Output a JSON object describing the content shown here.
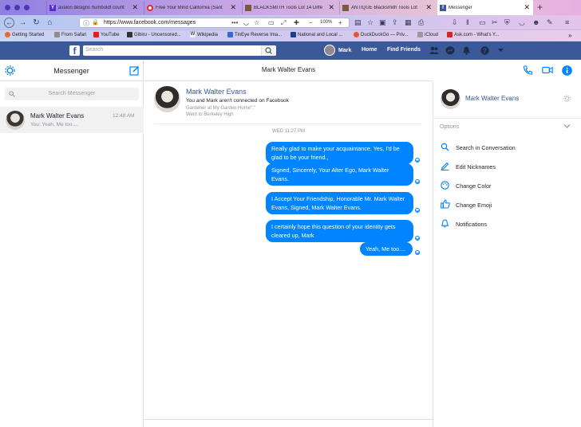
{
  "browser": {
    "tabs": [
      {
        "title": "avalon designs humboldt count",
        "icon_letter": "Y",
        "icon_color": "#5b2bd1"
      },
      {
        "title": "Free Your Mind California (Sant",
        "icon_letter": "",
        "icon_color": "#e22828"
      },
      {
        "title": "BLACKSMITH Tools Lot 14 Diffe",
        "icon_letter": "",
        "icon_color": "#7a5a3a"
      },
      {
        "title": "ANTIQUE Blacksmith Tools Lot",
        "icon_letter": "",
        "icon_color": "#7a5a3a"
      },
      {
        "title": "Messenger",
        "icon_letter": "f",
        "icon_color": "#3b5998"
      }
    ],
    "url": "https://www.facebook.com/messages",
    "zoom": "100%",
    "bookmarks": [
      "Getting Started",
      "From Safari",
      "YouTube",
      "Gibiru - Uncensored...",
      "Wikipedia",
      "TinEye Reverse Ima...",
      "National and Local ...",
      "DuckDuckGo — Priv...",
      "iCloud",
      "Ask.com - What's Y..."
    ]
  },
  "facebook": {
    "search_placeholder": "Search",
    "user_name": "Mark",
    "nav_home": "Home",
    "nav_find_friends": "Find Friends"
  },
  "messenger": {
    "title": "Messenger",
    "search_placeholder": "Search Messenger",
    "conversation": {
      "name": "Mark Walter Evans",
      "time": "12:48 AM",
      "preview": "You: Yeah, Me too...."
    }
  },
  "chat": {
    "header_title": "Mark Walter Evans",
    "profile_name": "Mark Walter Evans",
    "profile_status": "You and Mark aren't connected on Facebook",
    "profile_detail1": "Gardener at My Garden Home\";\"",
    "profile_detail2": "Went to Berkeley High",
    "timestamp": "WED 11:27 PM",
    "messages": [
      "Really glad to make your acquaintance. Yes, I'd be glad to be your friend.,",
      "Signed, Sincerely, Your Alter Ego, Mark Walter Evans.",
      "I Accept Your Friendship, Honorable Mr. Mark Walter Evans, Signed,  Mark Walter Evans.",
      "I certainly hope this question of your identity gets  cleared up, Mark",
      "Yeah, Me too...."
    ]
  },
  "details": {
    "name": "Mark Walter Evans",
    "options_label": "Options",
    "options": [
      {
        "label": "Search in Conversation",
        "icon": "search-icon"
      },
      {
        "label": "Edit Nicknames",
        "icon": "pencil-icon"
      },
      {
        "label": "Change Color",
        "icon": "palette-icon"
      },
      {
        "label": "Change Emoji",
        "icon": "thumbs-up-icon"
      },
      {
        "label": "Notifications",
        "icon": "bell-icon"
      }
    ]
  },
  "colors": {
    "facebook_blue": "#3b5998",
    "messenger_blue": "#0084ff",
    "link_blue": "#365899"
  }
}
